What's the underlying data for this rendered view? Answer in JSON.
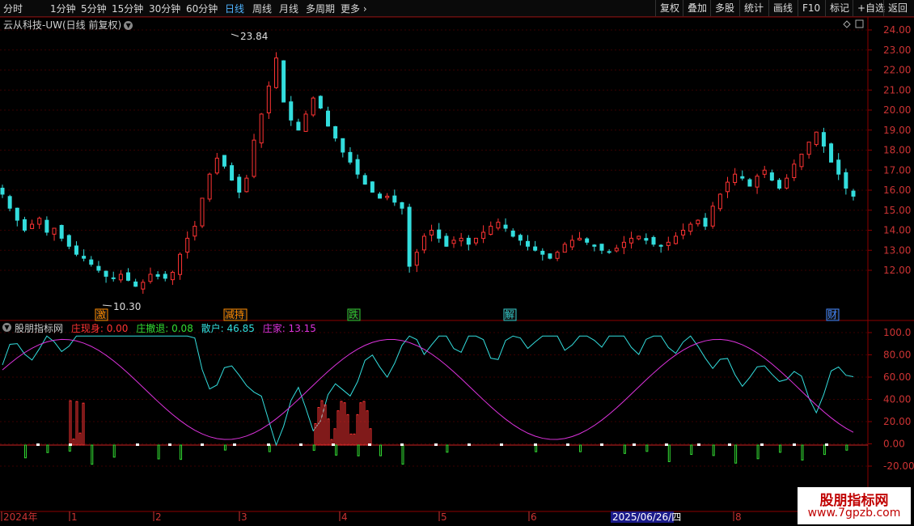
{
  "toolbar": {
    "periods": [
      {
        "label": "分时",
        "active": false
      },
      {
        "label": "1分钟",
        "active": false
      },
      {
        "label": "5分钟",
        "active": false
      },
      {
        "label": "15分钟",
        "active": false
      },
      {
        "label": "30分钟",
        "active": false
      },
      {
        "label": "60分钟",
        "active": false
      },
      {
        "label": "日线",
        "active": true
      },
      {
        "label": "周线",
        "active": false
      },
      {
        "label": "月线",
        "active": false
      },
      {
        "label": "多周期",
        "active": false
      },
      {
        "label": "更多",
        "active": false
      }
    ],
    "right_buttons": [
      "复权",
      "叠加",
      "多股",
      "统计",
      "画线",
      "F10",
      "标记",
      "+自选",
      "返回"
    ]
  },
  "title": "云从科技-UW(日线 前复权)",
  "price_axis": [
    "24.00",
    "23.00",
    "22.00",
    "21.00",
    "20.00",
    "19.00",
    "18.00",
    "17.00",
    "16.00",
    "15.00",
    "14.00",
    "13.00",
    "12.00"
  ],
  "annotations": {
    "high": "23.84",
    "low": "10.30"
  },
  "event_markers": [
    {
      "label": "激",
      "color": "#ff8c00"
    },
    {
      "label": "减持",
      "color": "#ff8c00"
    },
    {
      "label": "跌",
      "color": "#33cc33"
    },
    {
      "label": "解",
      "color": "#33cccc"
    },
    {
      "label": "财",
      "color": "#4488ff"
    }
  ],
  "indicator": {
    "name": "股朋指标网",
    "items": [
      {
        "label": "庄现身: 0.00",
        "color": "#ff3333"
      },
      {
        "label": "庄撤退: 0.08",
        "color": "#33dd33"
      },
      {
        "label": "散户: 46.85",
        "color": "#33dddd"
      },
      {
        "label": "庄家: 13.15",
        "color": "#dd33dd"
      }
    ],
    "axis": [
      "100.0",
      "80.00",
      "60.00",
      "40.00",
      "20.00",
      "0.00",
      "-20.00"
    ]
  },
  "date_axis": {
    "labels": [
      "2024年",
      "1",
      "2",
      "3",
      "4",
      "5",
      "6",
      "8"
    ],
    "current": "2025/06/26/四"
  },
  "watermark": {
    "title": "股朋指标网",
    "url": "www.7gpzb.com"
  },
  "chart_data": {
    "type": "candlestick",
    "title": "云从科技-UW(日线 前复权)",
    "ylim": [
      11,
      24.3
    ],
    "annotated_high": 23.84,
    "annotated_low": 10.3,
    "closes": [
      15.8,
      15.1,
      14.5,
      14.0,
      14.3,
      14.6,
      13.9,
      14.1,
      13.6,
      13.2,
      12.8,
      12.6,
      12.3,
      12.0,
      11.7,
      11.6,
      11.8,
      11.5,
      11.2,
      11.4,
      11.8,
      11.7,
      11.6,
      11.9,
      12.8,
      13.6,
      14.2,
      15.6,
      16.8,
      17.6,
      17.2,
      16.5,
      15.9,
      16.6,
      18.5,
      19.8,
      21.2,
      22.6,
      20.4,
      19.5,
      19.0,
      19.8,
      20.6,
      20.1,
      19.2,
      18.6,
      17.9,
      17.4,
      16.8,
      16.3,
      15.9,
      15.6,
      15.7,
      15.4,
      15.1,
      12.2,
      12.9,
      13.7,
      14.0,
      13.6,
      13.2,
      13.5,
      13.6,
      13.3,
      13.6,
      13.9,
      14.2,
      14.4,
      14.1,
      13.7,
      13.5,
      13.2,
      13.0,
      12.8,
      12.6,
      12.9,
      13.3,
      13.5,
      13.6,
      13.4,
      13.2,
      13.0,
      12.9,
      13.1,
      13.4,
      13.6,
      13.7,
      13.5,
      13.3,
      13.2,
      13.4,
      13.7,
      14.0,
      14.3,
      14.5,
      14.2,
      15.2,
      15.8,
      16.4,
      16.8,
      16.6,
      16.2,
      16.7,
      17.0,
      16.5,
      16.1,
      16.6,
      17.3,
      17.8,
      18.4,
      18.9,
      18.2,
      17.4,
      16.8,
      16.1,
      15.7
    ]
  }
}
